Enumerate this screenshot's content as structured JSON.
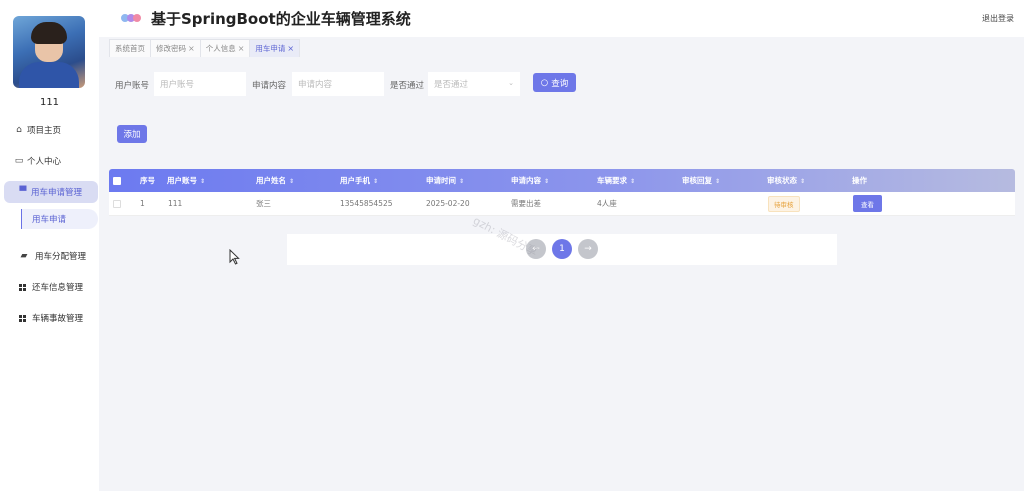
{
  "header": {
    "title": "基于SpringBoot的企业车辆管理系统",
    "logout": "退出登录"
  },
  "user": {
    "name": "111"
  },
  "sidebar": {
    "items": [
      {
        "label": "项目主页",
        "icon": "home-icon"
      },
      {
        "label": "个人中心",
        "icon": "profile-card-icon"
      },
      {
        "label": "用车申请管理",
        "icon": "monitor-icon"
      },
      {
        "label": "用车申请",
        "icon": ""
      },
      {
        "label": "用车分配管理",
        "icon": "wallet-icon"
      },
      {
        "label": "还车信息管理",
        "icon": "grid-icon"
      },
      {
        "label": "车辆事故管理",
        "icon": "grid-icon"
      }
    ]
  },
  "tabs": [
    {
      "label": "系统首页",
      "closable": false
    },
    {
      "label": "修改密码",
      "closable": true
    },
    {
      "label": "个人信息",
      "closable": true
    },
    {
      "label": "用车申请",
      "closable": true
    }
  ],
  "tab_close": "×",
  "search": {
    "fields": [
      {
        "label": "用户账号",
        "placeholder": "用户账号"
      },
      {
        "label": "申请内容",
        "placeholder": "申请内容"
      },
      {
        "label": "是否通过",
        "placeholder": "是否通过"
      }
    ],
    "button": "查询",
    "add_button": "添加"
  },
  "table": {
    "columns": [
      "序号",
      "用户账号",
      "用户姓名",
      "用户手机",
      "申请时间",
      "申请内容",
      "车辆要求",
      "审核回复",
      "审核状态",
      "操作"
    ],
    "rows": [
      {
        "index": "1",
        "account": "111",
        "name": "张三",
        "phone": "13545854525",
        "time": "2025-02-20",
        "content": "需要出差",
        "requirement": "4人座",
        "reply": "",
        "status": "待审核",
        "action": "查看"
      }
    ]
  },
  "pagination": {
    "prev": "←",
    "current": "1",
    "next": "→"
  },
  "watermark": "gzh: 源码分享",
  "colors": {
    "accent": "#6e77e8",
    "status_pending": "#e6a23c"
  }
}
